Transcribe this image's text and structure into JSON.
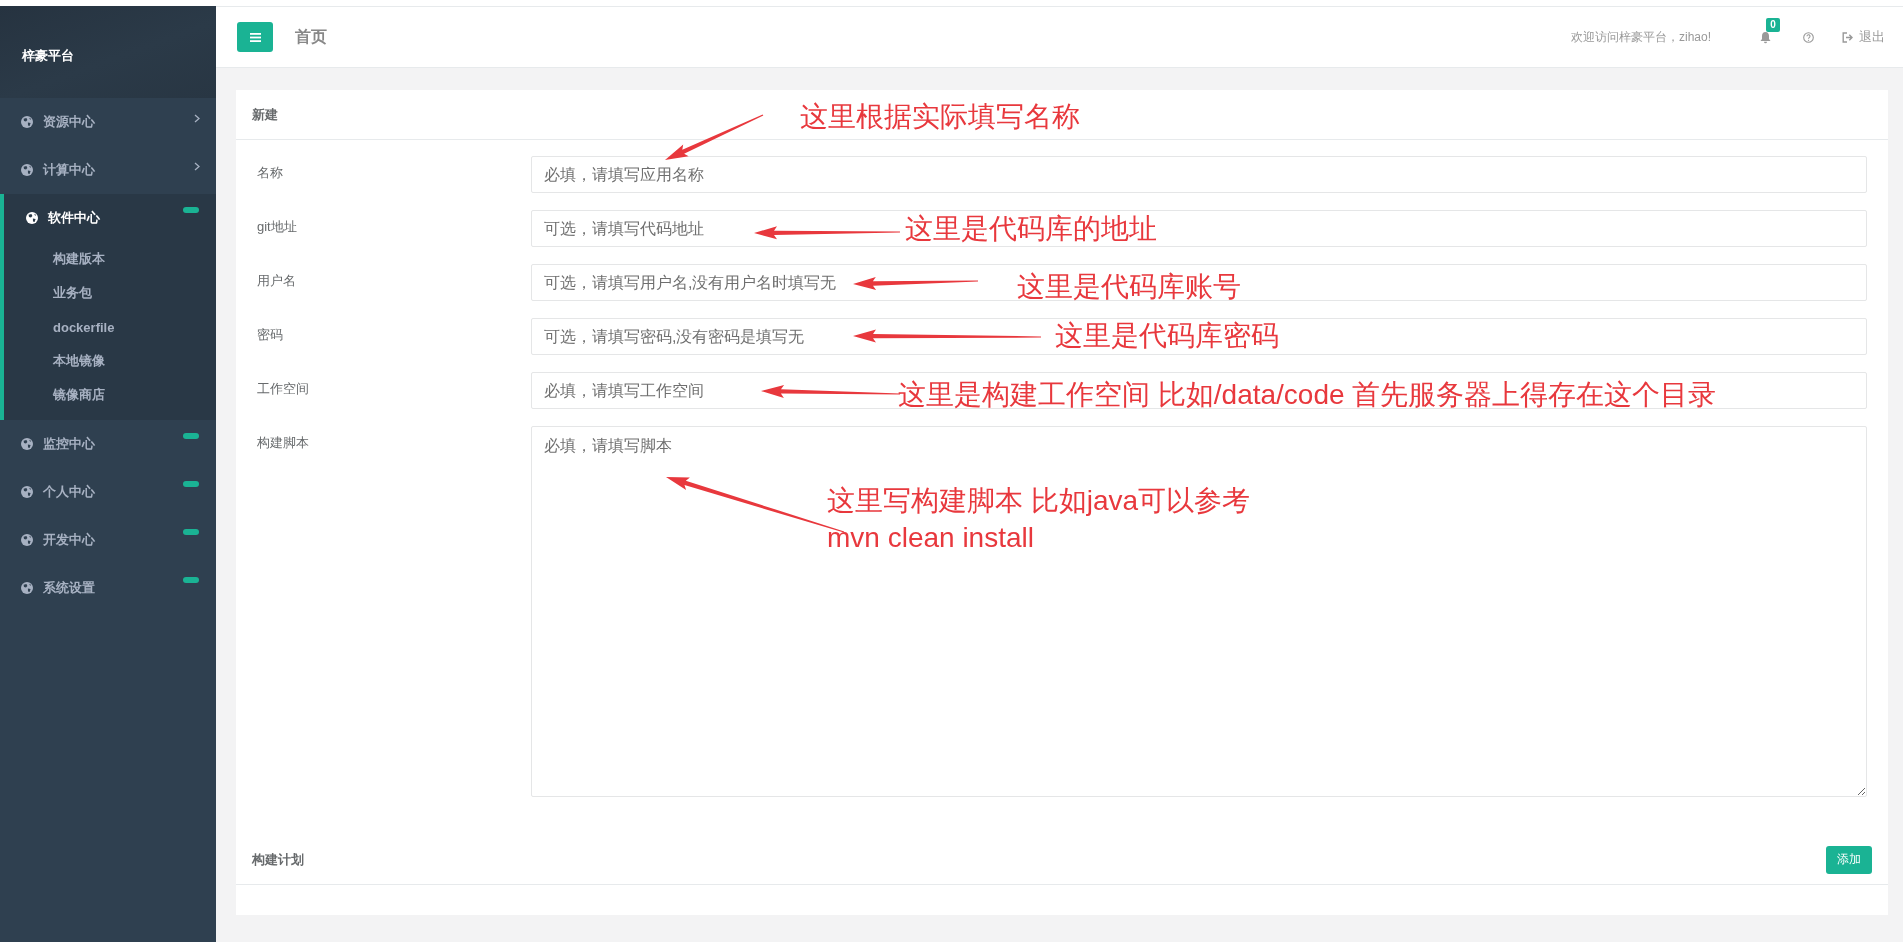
{
  "sidebar": {
    "brand": "梓豪平台",
    "items": [
      {
        "label": "资源中心",
        "kind": "chevron",
        "selected": false
      },
      {
        "label": "计算中心",
        "kind": "chevron",
        "selected": false
      },
      {
        "label": "软件中心",
        "kind": "dash",
        "selected": true,
        "children": [
          {
            "label": "构建版本",
            "selected": false
          },
          {
            "label": "业务包",
            "selected": false
          },
          {
            "label": "dockerfile",
            "selected": false
          },
          {
            "label": "本地镜像",
            "selected": false
          },
          {
            "label": "镜像商店",
            "selected": false
          }
        ]
      },
      {
        "label": "监控中心",
        "kind": "dash",
        "selected": false
      },
      {
        "label": "个人中心",
        "kind": "dash",
        "selected": false
      },
      {
        "label": "开发中心",
        "kind": "dash",
        "selected": false
      },
      {
        "label": "系统设置",
        "kind": "dash",
        "selected": false
      }
    ]
  },
  "header": {
    "title": "首页",
    "welcome": "欢迎访问梓豪平台，zihao!",
    "notification_count": "0",
    "logout": "退出"
  },
  "form_card": {
    "title": "新建",
    "fields": [
      {
        "label": "名称",
        "kind": "input",
        "placeholder": "必填，请填写应用名称",
        "note": "这里根据实际填写名称"
      },
      {
        "label": "git地址",
        "kind": "input",
        "placeholder": "可选，请填写代码地址",
        "note": "这里是代码库的地址"
      },
      {
        "label": "用户名",
        "kind": "input",
        "placeholder": "可选，请填写用户名,没有用户名时填写无",
        "note": "这里是代码库账号"
      },
      {
        "label": "密码",
        "kind": "input",
        "placeholder": "可选，请填写密码,没有密码是填写无",
        "note": "这里是代码库密码"
      },
      {
        "label": "工作空间",
        "kind": "input",
        "placeholder": "必填，请填写工作空间",
        "note": "这里是构建工作空间 比如/data/code 首先服务器上得存在这个目录"
      },
      {
        "label": "构建脚本",
        "kind": "textarea",
        "placeholder": "必填，请填写脚本",
        "note": "这里写构建脚本 比如java可以参考\nmvn clean install"
      }
    ]
  },
  "plan_card": {
    "title": "构建计划",
    "add_button": "添加"
  }
}
